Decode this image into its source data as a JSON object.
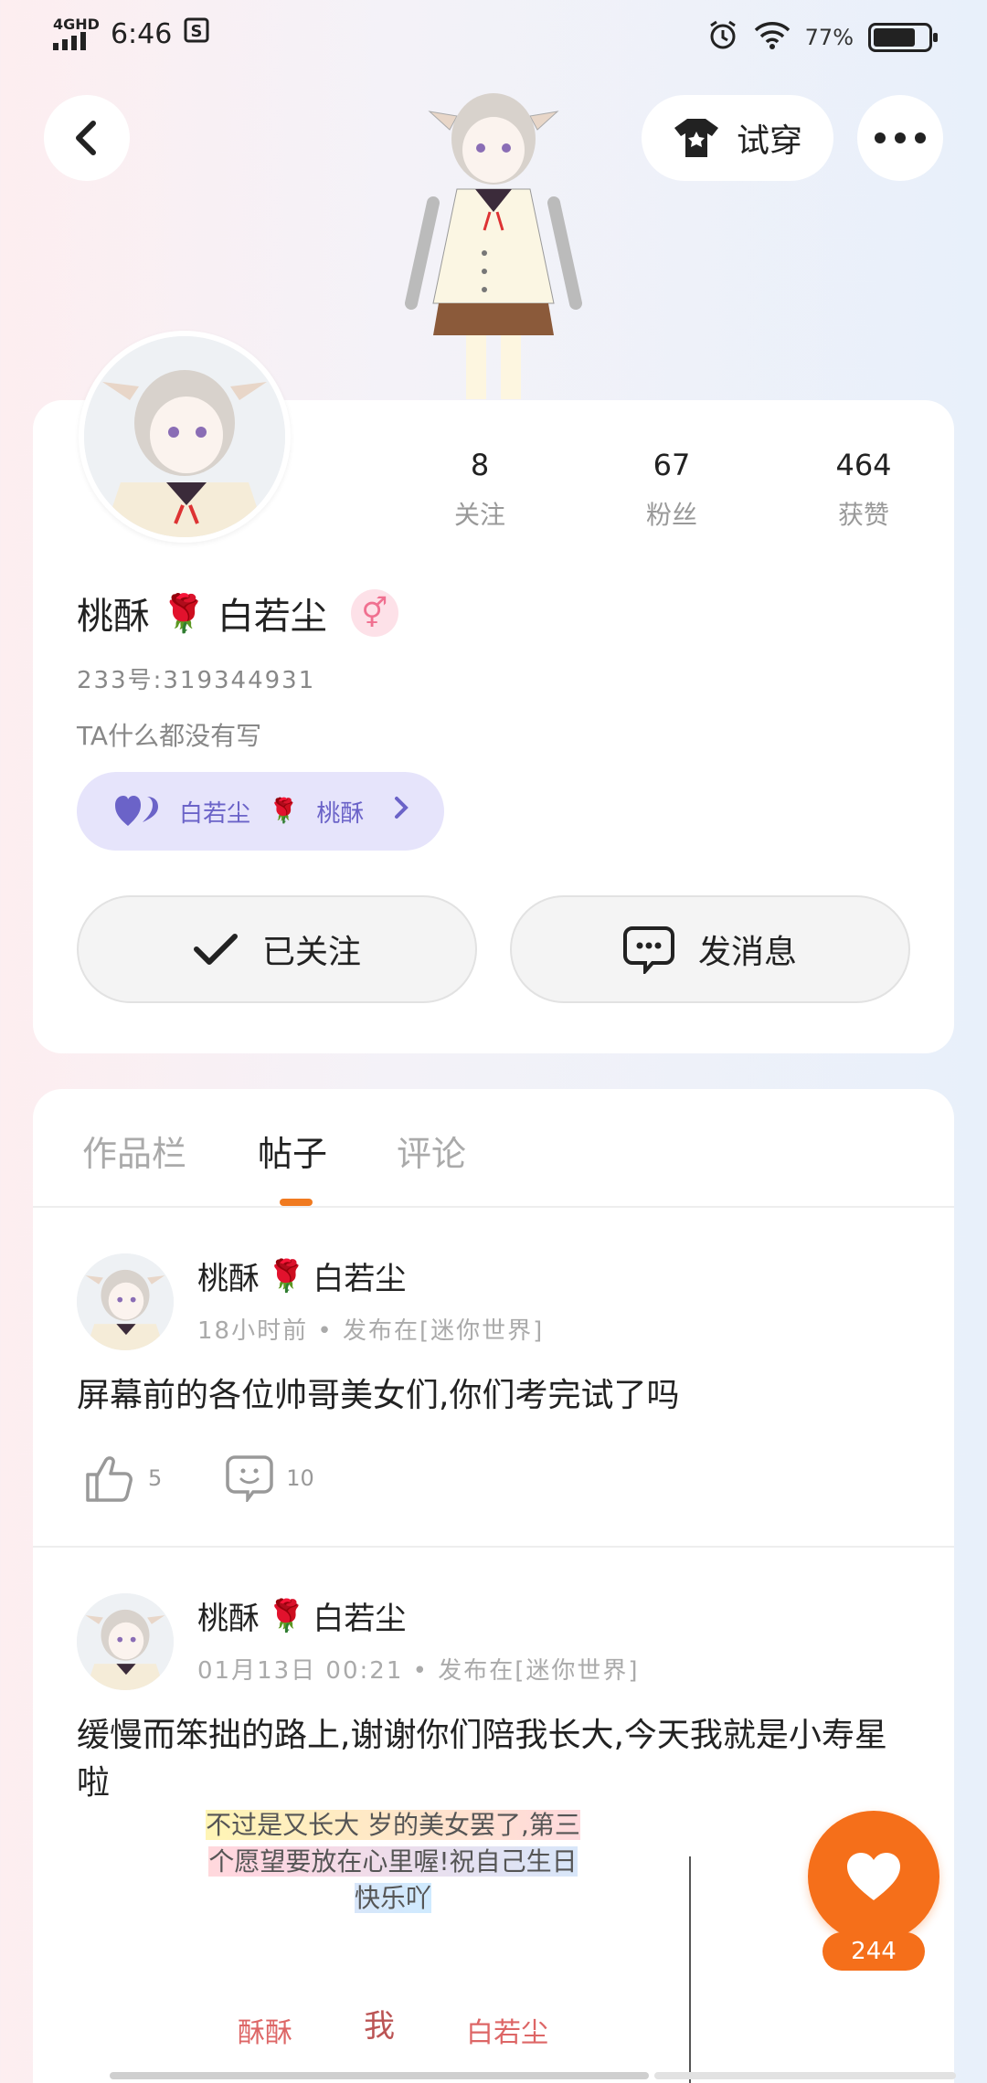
{
  "status_bar": {
    "network": "4GHD",
    "time": "6:46",
    "battery": "77%",
    "battery_level": 0.77
  },
  "header": {
    "try_on_label": "试穿"
  },
  "profile": {
    "stats": [
      {
        "value": "8",
        "label": "关注"
      },
      {
        "value": "67",
        "label": "粉丝"
      },
      {
        "value": "464",
        "label": "获赞"
      }
    ],
    "name_left": "桃酥",
    "name_emoji": "🌹",
    "name_right": "白若尘",
    "gender_symbol": "⚥",
    "uid": "233号:319344931",
    "bio": "TA什么都没有写",
    "couple": {
      "left": "白若尘",
      "emoji": "🌹",
      "right": "桃酥"
    },
    "follow_label": "已关注",
    "message_label": "发消息"
  },
  "tabs": [
    {
      "label": "作品栏",
      "active": false
    },
    {
      "label": "帖子",
      "active": true
    },
    {
      "label": "评论",
      "active": false
    }
  ],
  "posts": [
    {
      "author_left": "桃酥",
      "author_emoji": "🌹",
      "author_right": "白若尘",
      "meta": "18小时前 • 发布在[迷你世界]",
      "text": "屏幕前的各位帅哥美女们,你们考完试了吗",
      "likes": "5",
      "comments": "10"
    },
    {
      "author_left": "桃酥",
      "author_emoji": "🌹",
      "author_right": "白若尘",
      "meta": "01月13日 00:21 • 发布在[迷你世界]",
      "text": "缓慢而笨拙的路上,谢谢你们陪我长大,今天我就是小寿星啦",
      "image_caption": "不过是又长大 岁的美女罢了,第三个愿望要放在心里喔!祝自己生日快乐吖",
      "image_labels": [
        "酥酥",
        "我",
        "白若尘"
      ]
    }
  ],
  "fab": {
    "count": "244"
  },
  "colors": {
    "accent": "#f56f1a",
    "couple_bg": "#e6e4fb",
    "couple_text": "#6b63c8",
    "gender_bg": "#fde1e8"
  }
}
